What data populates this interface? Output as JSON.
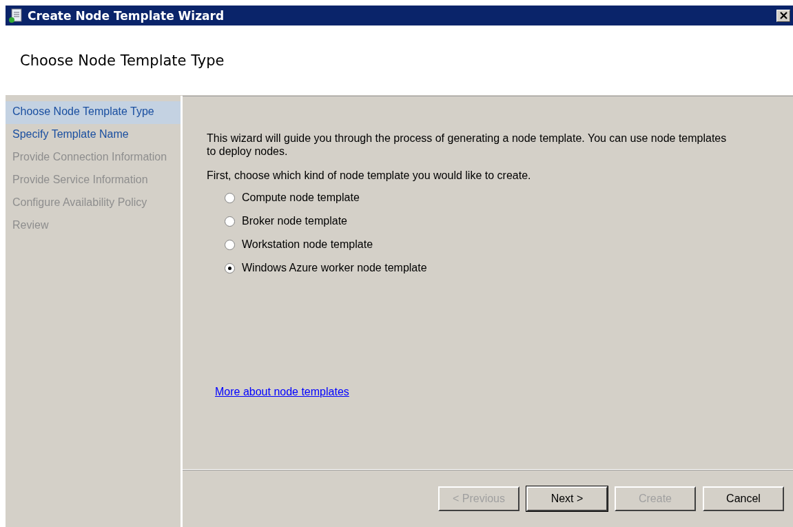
{
  "window": {
    "title": "Create Node Template Wizard"
  },
  "header": {
    "title": "Choose Node Template Type"
  },
  "steps": [
    {
      "label": "Choose Node Template Type",
      "selected": true,
      "enabled": true
    },
    {
      "label": "Specify Template Name",
      "selected": false,
      "enabled": true
    },
    {
      "label": "Provide Connection Information",
      "selected": false,
      "enabled": false
    },
    {
      "label": "Provide Service Information",
      "selected": false,
      "enabled": false
    },
    {
      "label": "Configure Availability Policy",
      "selected": false,
      "enabled": false
    },
    {
      "label": "Review",
      "selected": false,
      "enabled": false
    }
  ],
  "intro": "This wizard will guide you through the process of generating a node template. You can use node templates to deploy nodes.",
  "prompt": "First, choose which kind of node template you would like to create.",
  "options": [
    {
      "label": "Compute node template",
      "selected": false
    },
    {
      "label": "Broker node template",
      "selected": false
    },
    {
      "label": "Workstation node template",
      "selected": false
    },
    {
      "label": "Windows Azure worker node template",
      "selected": true
    }
  ],
  "link": "More about node templates",
  "buttons": [
    {
      "label": "< Previous",
      "disabled": true,
      "default": false
    },
    {
      "label": "Next >",
      "disabled": false,
      "default": true
    },
    {
      "label": "Create",
      "disabled": true,
      "default": false
    },
    {
      "label": "Cancel",
      "disabled": false,
      "default": false
    }
  ]
}
